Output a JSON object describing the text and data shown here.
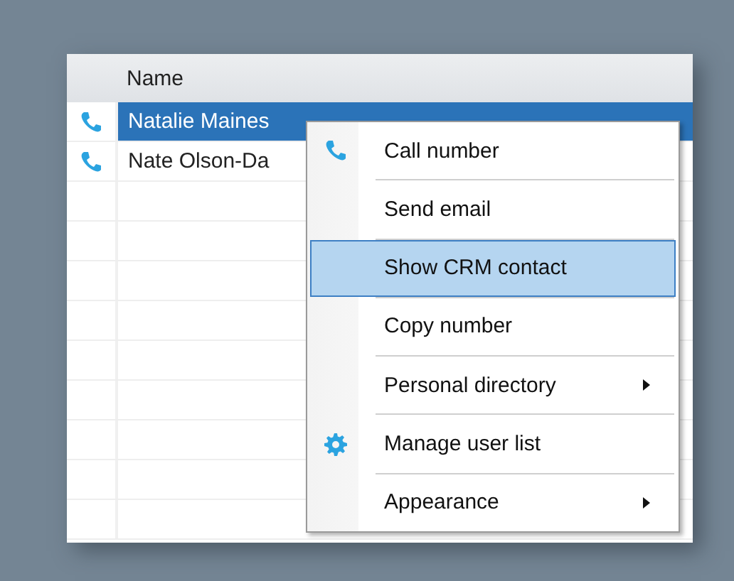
{
  "table": {
    "columns": [
      {
        "label": "Name"
      }
    ],
    "rows": [
      {
        "name": "Natalie Maines",
        "selected": true
      },
      {
        "name": "Nate Olson-Da",
        "selected": false
      }
    ]
  },
  "context_menu": {
    "items": [
      {
        "label": "Call number",
        "kind": "call",
        "selected": false
      },
      {
        "label": "Send email",
        "kind": "plain",
        "selected": false
      },
      {
        "label": "Show CRM contact",
        "kind": "plain",
        "selected": true
      },
      {
        "label": "Copy number",
        "kind": "plain",
        "selected": false
      },
      {
        "label": "Personal directory",
        "kind": "submenu",
        "selected": false
      },
      {
        "label": "Manage user list",
        "kind": "settings",
        "selected": false
      },
      {
        "label": "Appearance",
        "kind": "submenu",
        "selected": false
      }
    ]
  }
}
